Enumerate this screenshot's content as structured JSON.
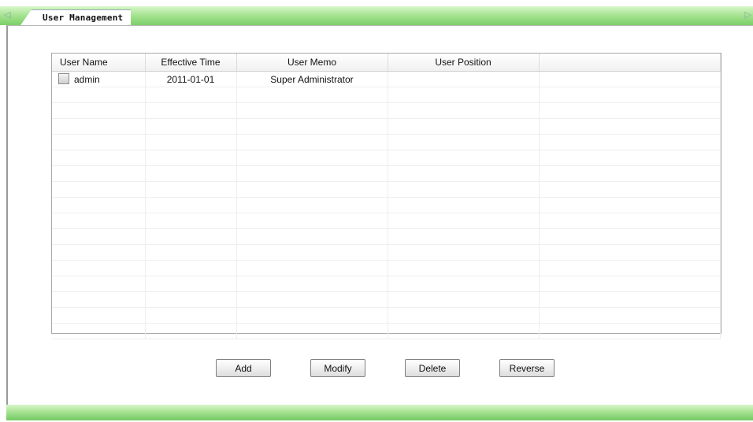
{
  "tab": {
    "title": "User Management"
  },
  "colors": {
    "accent_green": "#8fd978",
    "panel_border": "#9a9a9a"
  },
  "table": {
    "columns": [
      "User Name",
      "Effective Time",
      "User Memo",
      "User Position",
      ""
    ],
    "rows": [
      {
        "name": "admin",
        "effective_time": "2011-01-01",
        "memo": "Super Administrator",
        "position": "",
        "extra": ""
      }
    ]
  },
  "buttons": {
    "add": "Add",
    "modify": "Modify",
    "delete": "Delete",
    "reverse": "Reverse"
  }
}
